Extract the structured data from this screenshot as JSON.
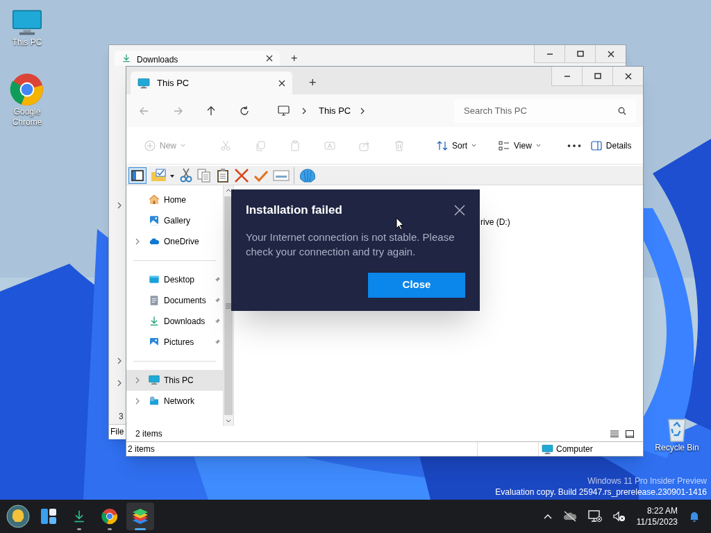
{
  "desktop_icons": [
    {
      "kind": "pc",
      "label": "This PC"
    },
    {
      "kind": "chrome",
      "label": "Google Chrome"
    }
  ],
  "recycle_bin": {
    "label": "Recycle Bin"
  },
  "back_window": {
    "tab": "Downloads",
    "new_tab": "+",
    "left_texts": [
      "3",
      "File"
    ]
  },
  "window": {
    "tab": "This PC",
    "new_tab": "+",
    "breadcrumb": [
      "This PC"
    ],
    "search": {
      "placeholder": "Search This PC"
    },
    "command_bar": [
      {
        "kind": "new",
        "label": "New",
        "disabled": true
      },
      {
        "kind": "cut",
        "disabled": true
      },
      {
        "kind": "copy",
        "disabled": true
      },
      {
        "kind": "paste",
        "disabled": true
      },
      {
        "kind": "rename",
        "disabled": true
      },
      {
        "kind": "share",
        "disabled": true
      },
      {
        "kind": "delete",
        "disabled": true
      },
      {
        "kind": "sort",
        "label": "Sort",
        "disabled": false
      },
      {
        "kind": "view",
        "label": "View",
        "disabled": false
      },
      {
        "kind": "more",
        "disabled": false
      },
      {
        "kind": "details",
        "label": "Details",
        "disabled": false
      }
    ],
    "nav_groups": [
      [
        {
          "kind": "home",
          "label": "Home",
          "expandable": false,
          "pinned": false,
          "selected": false
        },
        {
          "kind": "gallery",
          "label": "Gallery",
          "expandable": false,
          "pinned": false,
          "selected": false
        },
        {
          "kind": "onedrive",
          "label": "OneDrive",
          "expandable": true,
          "pinned": false,
          "selected": false
        }
      ],
      [
        {
          "kind": "desktop",
          "label": "Desktop",
          "expandable": false,
          "pinned": true,
          "selected": false
        },
        {
          "kind": "documents",
          "label": "Documents",
          "expandable": false,
          "pinned": true,
          "selected": false
        },
        {
          "kind": "downloads",
          "label": "Downloads",
          "expandable": false,
          "pinned": true,
          "selected": false
        },
        {
          "kind": "pictures",
          "label": "Pictures",
          "expandable": false,
          "pinned": true,
          "selected": false
        }
      ],
      [
        {
          "kind": "pc",
          "label": "This PC",
          "expandable": true,
          "pinned": false,
          "selected": true
        },
        {
          "kind": "network",
          "label": "Network",
          "expandable": true,
          "pinned": false,
          "selected": false
        }
      ]
    ],
    "content_items": [
      "rive (D:)"
    ],
    "item_count": "2 items",
    "status_bar": {
      "items": "2 items",
      "location": "Computer"
    }
  },
  "dialog": {
    "title": "Installation failed",
    "message": "Your Internet connection is not stable. Please check your connection and try again.",
    "button": "Close"
  },
  "desktop_notice": [
    "Windows 11 Pro Insider Preview",
    "Evaluation copy. Build 25947.rs_prerelease.230901-1416"
  ],
  "taskbar": {
    "apps": [
      {
        "kind": "start",
        "running": false,
        "active": false
      },
      {
        "kind": "widgets",
        "running": false,
        "active": false
      },
      {
        "kind": "download",
        "running": true,
        "active": false
      },
      {
        "kind": "chrome",
        "running": true,
        "active": false
      },
      {
        "kind": "bluestacks",
        "running": true,
        "active": true
      }
    ],
    "time": "8:22 AM",
    "date": "11/15/2023"
  }
}
